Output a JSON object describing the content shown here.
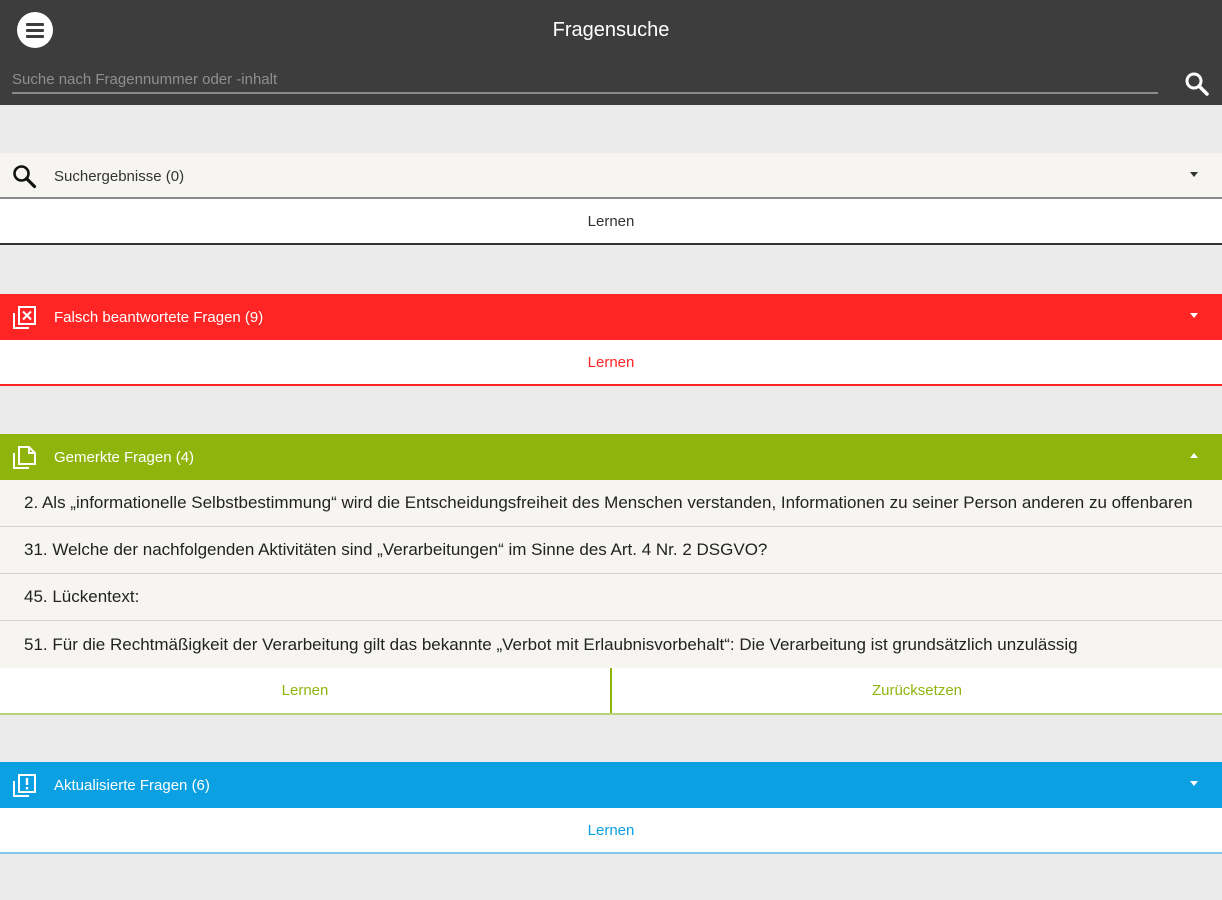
{
  "header": {
    "title": "Fragensuche",
    "search_placeholder": "Suche nach Fragennummer oder -inhalt",
    "search_value": "",
    "icons": [
      "menu-icon",
      "search-icon"
    ]
  },
  "sections": {
    "search": {
      "title": "Suchergebnisse (0)",
      "action": "Lernen",
      "expanded": false,
      "colors": {
        "header_bg": "#f6f5f2",
        "header_text": "#333333",
        "accent": "#333333",
        "border": "#333333"
      }
    },
    "wrong": {
      "title": "Falsch beantwortete Fragen (9)",
      "action": "Lernen",
      "expanded": false,
      "colors": {
        "header_bg": "#fe2524",
        "header_text": "#ffffff",
        "accent": "#fe2524"
      }
    },
    "marked": {
      "title": "Gemerkte Fragen (4)",
      "expanded": true,
      "items": [
        "2. Als „informationelle Selbstbestimmung“ wird die Entscheidungsfreiheit des Menschen verstanden, Informationen zu seiner Person anderen zu offenbaren",
        "31. Welche der nachfolgenden Aktivitäten sind „Verarbeitungen“ im Sinne des Art. 4 Nr. 2 DSGVO?",
        "45. Lückentext:",
        "51. Für die Rechtmäßigkeit der Verarbeitung gilt das bekannte „Verbot mit Erlaubnisvorbehalt“: Die Verarbeitung ist grundsätzlich unzulässig"
      ],
      "action_learn": "Lernen",
      "action_reset": "Zurücksetzen",
      "colors": {
        "header_bg": "#8fb50d",
        "header_text": "#ffffff",
        "accent": "#8fb50d"
      }
    },
    "updated": {
      "title": "Aktualisierte Fragen (6)",
      "action": "Lernen",
      "expanded": false,
      "colors": {
        "header_bg": "#0aa0e1",
        "header_text": "#ffffff",
        "accent": "#0aa0e1"
      }
    }
  },
  "colors": {
    "topbar": "#3d3d3d",
    "background": "#ebebeb"
  }
}
